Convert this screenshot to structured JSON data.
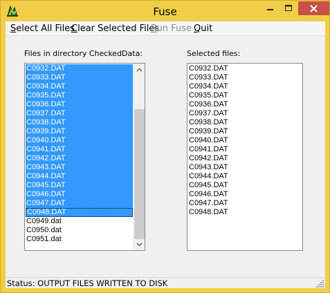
{
  "window": {
    "title": "Fuse"
  },
  "menu": {
    "select_all": {
      "ul": "S",
      "rest": "elect All Files"
    },
    "clear_selected": {
      "ul": "C",
      "rest": "lear Selected Files"
    },
    "run_fuse": {
      "ul": "R",
      "rest": "un Fuse"
    },
    "quit": {
      "ul": "Q",
      "rest": "uit"
    }
  },
  "left_panel": {
    "label": "Files in directory CheckedData:",
    "items": [
      {
        "name": "C0932.DAT",
        "selected": true
      },
      {
        "name": "C0933.DAT",
        "selected": true
      },
      {
        "name": "C0934.DAT",
        "selected": true
      },
      {
        "name": "C0935.DAT",
        "selected": true
      },
      {
        "name": "C0936.DAT",
        "selected": true
      },
      {
        "name": "C0937.DAT",
        "selected": true
      },
      {
        "name": "C0938.DAT",
        "selected": true
      },
      {
        "name": "C0939.DAT",
        "selected": true
      },
      {
        "name": "C0940.DAT",
        "selected": true
      },
      {
        "name": "C0941.DAT",
        "selected": true
      },
      {
        "name": "C0942.DAT",
        "selected": true
      },
      {
        "name": "C0943.DAT",
        "selected": true
      },
      {
        "name": "C0944.DAT",
        "selected": true
      },
      {
        "name": "C0945.DAT",
        "selected": true
      },
      {
        "name": "C0946.DAT",
        "selected": true
      },
      {
        "name": "C0947.DAT",
        "selected": true
      },
      {
        "name": "C0948.DAT",
        "selected": true,
        "focused": true
      },
      {
        "name": "C0949.dat",
        "selected": false
      },
      {
        "name": "C0950.dat",
        "selected": false
      },
      {
        "name": "C0951.dat",
        "selected": false
      }
    ]
  },
  "right_panel": {
    "label": "Selected files:",
    "items": [
      "C0932.DAT",
      "C0933.DAT",
      "C0934.DAT",
      "C0935.DAT",
      "C0936.DAT",
      "C0937.DAT",
      "C0938.DAT",
      "C0939.DAT",
      "C0940.DAT",
      "C0941.DAT",
      "C0942.DAT",
      "C0943.DAT",
      "C0944.DAT",
      "C0945.DAT",
      "C0946.DAT",
      "C0947.DAT",
      "C0948.DAT"
    ]
  },
  "status": {
    "text": "Status: OUTPUT FILES WRITTEN TO DISK"
  },
  "colors": {
    "titlebar": "#f0ce48",
    "selection": "#3399ff",
    "close_button": "#c7504a"
  }
}
